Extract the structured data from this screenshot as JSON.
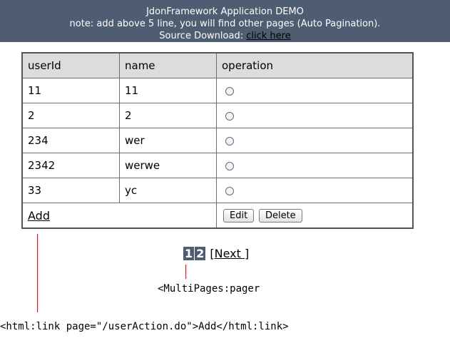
{
  "banner": {
    "title": "JdonFramework Application DEMO",
    "note": "note: add above 5 line, you will find other pages (Auto Pagination).",
    "source_prefix": "Source Download: ",
    "source_link": "click here"
  },
  "table": {
    "headers": [
      "userId",
      "name",
      "operation"
    ],
    "rows": [
      {
        "userId": "11",
        "name": "11"
      },
      {
        "userId": "2",
        "name": "2"
      },
      {
        "userId": "234",
        "name": "wer"
      },
      {
        "userId": "2342",
        "name": "werwe"
      },
      {
        "userId": "33",
        "name": "yc"
      }
    ],
    "add_label": "Add",
    "edit_label": "Edit",
    "delete_label": "Delete"
  },
  "pager": {
    "page1": "1",
    "page2": "2",
    "next_label": "[Next ]"
  },
  "annotations": {
    "pager_tag": "<MultiPages:pager",
    "link_tag": "<html:link page=\"/userAction.do\">Add</html:link>"
  },
  "colors": {
    "banner_bg": "#4e5d72",
    "annotation_line": "#e02020"
  }
}
